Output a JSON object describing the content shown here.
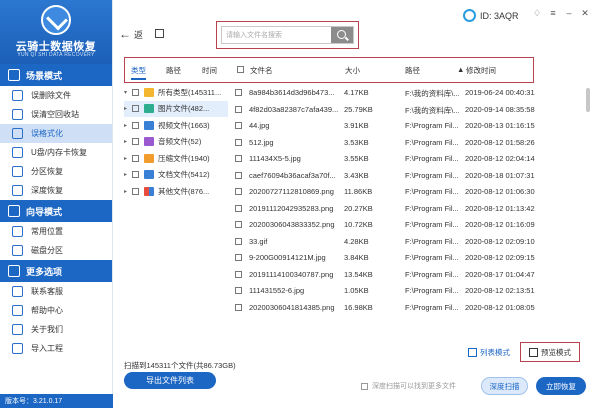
{
  "app": {
    "title": "云骑士数据恢复",
    "subtitle": "YUN QI SHI DATA RECOVERY",
    "version": "版本号：3.21.0.17",
    "id_label": "ID: 3AQR"
  },
  "sidebar": {
    "sections": [
      {
        "title": "场景模式",
        "items": [
          {
            "label": "误删除文件",
            "icon": "trash-file-icon"
          },
          {
            "label": "误清空回收站",
            "icon": "recycle-bin-icon"
          },
          {
            "label": "误格式化",
            "icon": "format-drive-icon",
            "active": true
          },
          {
            "label": "U盘/内存卡恢复",
            "icon": "usb-drive-icon"
          },
          {
            "label": "分区恢复",
            "icon": "partition-icon"
          },
          {
            "label": "深度恢复",
            "icon": "deep-scan-icon"
          }
        ]
      },
      {
        "title": "向导模式",
        "items": [
          {
            "label": "常用位置",
            "icon": "common-location-icon"
          },
          {
            "label": "磁盘分区",
            "icon": "disk-partition-icon"
          }
        ]
      },
      {
        "title": "更多选项",
        "items": [
          {
            "label": "联系客服",
            "icon": "customer-service-icon"
          },
          {
            "label": "帮助中心",
            "icon": "help-icon"
          },
          {
            "label": "关于我们",
            "icon": "about-icon"
          },
          {
            "label": "导入工程",
            "icon": "import-project-icon"
          }
        ]
      }
    ]
  },
  "toolbar": {
    "back_label": "返",
    "search_placeholder": "请输入文件名搜索"
  },
  "header": {
    "tab_type": "类型",
    "tab_path": "路径",
    "tab_time": "时间",
    "col_name": "文件名",
    "col_size": "大小",
    "col_path": "路径",
    "col_date": "修改时间",
    "sort_indicator": "▲"
  },
  "tree": [
    {
      "caret": "▾",
      "label": "所有类型(145311...",
      "color": "#f3b62e"
    },
    {
      "caret": "▸",
      "label": "图片文件(482...",
      "color": "#2eae8f",
      "selected": true
    },
    {
      "caret": "▸",
      "label": "视频文件(1663)",
      "color": "#3a7fd6"
    },
    {
      "caret": "▸",
      "label": "音频文件(52)",
      "color": "#9b59d0"
    },
    {
      "caret": "▸",
      "label": "压缩文件(1940)",
      "color": "#f39c2e"
    },
    {
      "caret": "▸",
      "label": "文档文件(5412)",
      "color": "#3a7fd6"
    },
    {
      "caret": "▸",
      "label": "其他文件(876...",
      "color": "#e74c3c"
    }
  ],
  "files": [
    {
      "name": "8a984b3614d3d96b473...",
      "size": "4.17KB",
      "path": "F:\\我的资料库\\...",
      "date": "2019-06-24 00:40:31"
    },
    {
      "name": "4f82d03a82387c7afa439...",
      "size": "25.79KB",
      "path": "F:\\我的资料库\\...",
      "date": "2020-09-14 08:35:58"
    },
    {
      "name": "44.jpg",
      "size": "3.91KB",
      "path": "F:\\Program Fil...",
      "date": "2020-08-13 01:16:15"
    },
    {
      "name": "512.jpg",
      "size": "3.53KB",
      "path": "F:\\Program Fil...",
      "date": "2020-08-12 01:58:26"
    },
    {
      "name": "111434X5-5.jpg",
      "size": "3.55KB",
      "path": "F:\\Program Fil...",
      "date": "2020-08-12 02:04:14"
    },
    {
      "name": "caef76094b36acaf3a70f...",
      "size": "3.43KB",
      "path": "F:\\Program Fil...",
      "date": "2020-08-18 01:07:31"
    },
    {
      "name": "20200727112810869.png",
      "size": "11.86KB",
      "path": "F:\\Program Fil...",
      "date": "2020-08-12 01:06:30"
    },
    {
      "name": "20191112042935283.png",
      "size": "20.27KB",
      "path": "F:\\Program Fil...",
      "date": "2020-08-12 01:13:42"
    },
    {
      "name": "20200306043833352.png",
      "size": "10.72KB",
      "path": "F:\\Program Fil...",
      "date": "2020-08-12 01:16:09"
    },
    {
      "name": "33.gif",
      "size": "4.28KB",
      "path": "F:\\Program Fil...",
      "date": "2020-08-12 02:09:10"
    },
    {
      "name": "9-200G00914121M.jpg",
      "size": "3.84KB",
      "path": "F:\\Program Fil...",
      "date": "2020-08-12 02:09:15"
    },
    {
      "name": "20191114100340787.png",
      "size": "13.54KB",
      "path": "F:\\Program Fil...",
      "date": "2020-08-17 01:04:47"
    },
    {
      "name": "111431552-6.jpg",
      "size": "1.05KB",
      "path": "F:\\Program Fil...",
      "date": "2020-08-12 02:13:51"
    },
    {
      "name": "20200306041814385.png",
      "size": "16.98KB",
      "path": "F:\\Program Fil...",
      "date": "2020-08-12 01:08:05"
    }
  ],
  "view": {
    "list_label": "列表模式",
    "preview_label": "预览模式"
  },
  "footer": {
    "summary": "扫描到145311个文件(共86.73GB)",
    "export_label": "导出文件列表",
    "deep_option": "深度扫描可以找到更多文件",
    "deep_scan_label": "深度扫描",
    "recover_label": "立即恢复"
  },
  "colors": {
    "primary": "#1c66c4",
    "highlight_border": "#b8434f",
    "active_nav_bg": "#cfe0f6"
  }
}
